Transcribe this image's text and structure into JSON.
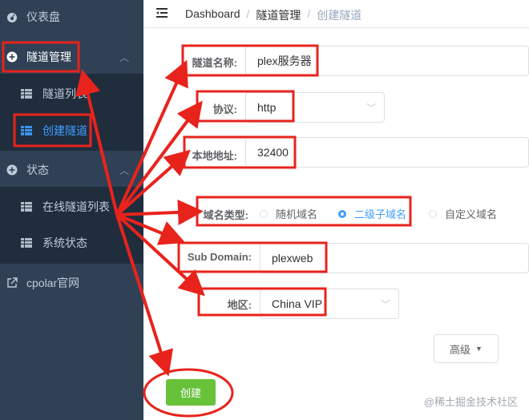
{
  "sidebar": {
    "dashboard": "仪表盘",
    "tunnel_mgmt": "隧道管理",
    "tunnel_list": "隧道列表",
    "create_tunnel": "创建隧道",
    "status": "状态",
    "online_tunnels": "在线隧道列表",
    "system_status": "系统状态",
    "cpolar_site": "cpolar官网"
  },
  "breadcrumb": {
    "home": "Dashboard",
    "sep": "/",
    "section": "隧道管理",
    "current": "创建隧道"
  },
  "form": {
    "name_label": "隧道名称:",
    "name_value": "plex服务器",
    "protocol_label": "协议:",
    "protocol_value": "http",
    "local_label": "本地地址:",
    "local_value": "32400",
    "domain_type_label": "域名类型:",
    "domain_type_options": [
      "随机域名",
      "二级子域名",
      "自定义域名"
    ],
    "domain_type_selected": "二级子域名",
    "subdomain_label": "Sub Domain:",
    "subdomain_value": "plexweb",
    "region_label": "地区:",
    "region_value": "China VIP",
    "advanced_label": "高级",
    "create_label": "创建"
  },
  "watermark": "@稀土掘金技术社区",
  "colors": {
    "sidebar_bg": "#304156",
    "submenu_bg": "#1f2d3d",
    "active": "#409eff",
    "create_button": "#67c23a",
    "annotation": "#e8231c"
  }
}
